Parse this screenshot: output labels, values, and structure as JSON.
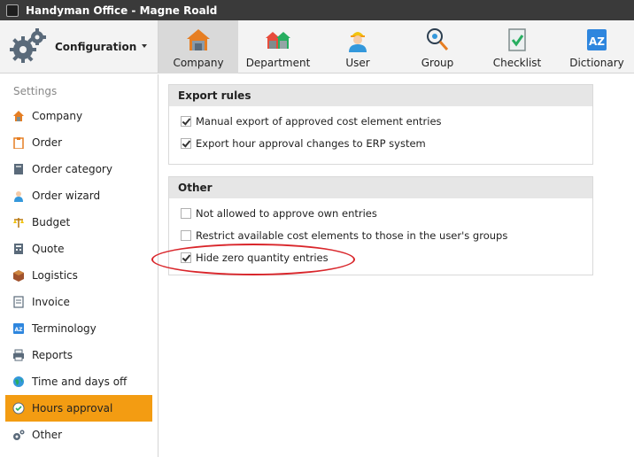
{
  "window": {
    "title": "Handyman Office - Magne Roald"
  },
  "config": {
    "label": "Configuration"
  },
  "tabs": [
    {
      "label": "Company",
      "icon": "house-icon",
      "active": true
    },
    {
      "label": "Department",
      "icon": "houses-icon",
      "active": false
    },
    {
      "label": "User",
      "icon": "worker-icon",
      "active": false
    },
    {
      "label": "Group",
      "icon": "group-icon",
      "active": false
    },
    {
      "label": "Checklist",
      "icon": "checklist-icon",
      "active": false
    },
    {
      "label": "Dictionary",
      "icon": "dictionary-icon",
      "active": false
    }
  ],
  "sidebar": {
    "heading": "Settings",
    "items": [
      {
        "label": "Company",
        "icon": "house-icon",
        "active": false
      },
      {
        "label": "Order",
        "icon": "clipboard-icon",
        "active": false
      },
      {
        "label": "Order category",
        "icon": "book-icon",
        "active": false
      },
      {
        "label": "Order wizard",
        "icon": "wizard-icon",
        "active": false
      },
      {
        "label": "Budget",
        "icon": "scale-icon",
        "active": false
      },
      {
        "label": "Quote",
        "icon": "calculator-icon",
        "active": false
      },
      {
        "label": "Logistics",
        "icon": "box-icon",
        "active": false
      },
      {
        "label": "Invoice",
        "icon": "document-icon",
        "active": false
      },
      {
        "label": "Terminology",
        "icon": "dictionary-icon",
        "active": false
      },
      {
        "label": "Reports",
        "icon": "printer-icon",
        "active": false
      },
      {
        "label": "Time and days off",
        "icon": "globe-icon",
        "active": false
      },
      {
        "label": "Hours approval",
        "icon": "clock-check-icon",
        "active": true
      },
      {
        "label": "Other",
        "icon": "gears-icon",
        "active": false
      }
    ]
  },
  "export_rules": {
    "title": "Export rules",
    "options": [
      {
        "label": "Manual export of approved cost element entries",
        "checked": true
      },
      {
        "label": "Export hour approval changes to ERP system",
        "checked": true
      }
    ]
  },
  "other": {
    "title": "Other",
    "options": [
      {
        "label": "Not allowed to approve own entries",
        "checked": false
      },
      {
        "label": "Restrict available cost elements to those in the user's groups",
        "checked": false
      },
      {
        "label": "Hide zero quantity entries",
        "checked": true
      }
    ]
  },
  "colors": {
    "accent": "#f39c12",
    "titlebar": "#3a3a3a",
    "highlight": "#d9262b"
  }
}
